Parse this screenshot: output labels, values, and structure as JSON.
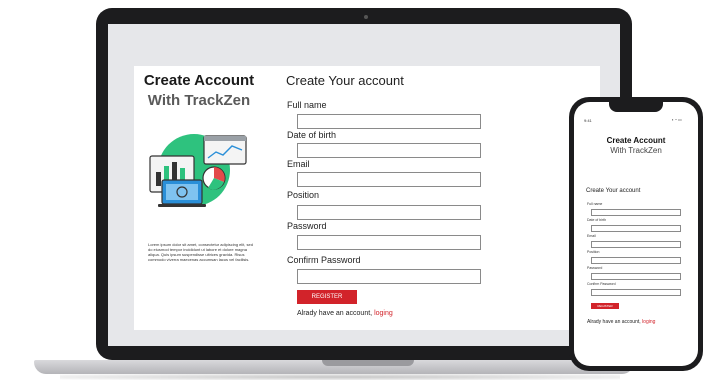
{
  "laptop": {
    "left_title_line1": "Create Account",
    "left_title_line2": "With TrackZen",
    "left_paragraph": "Lorem ipsum dolor sit amet, consectetur adipiscing elit, sed do eiusmod tempor incididunt ut labore et dolore magna aliqua. Quis ipsum suspendisse ultrices gravida. Risus commodo viverra maecenas accumsan lacus vel facilisis.",
    "form_heading": "Create Your account",
    "fields": [
      {
        "label": "Full name",
        "value": ""
      },
      {
        "label": "Date of birth",
        "value": ""
      },
      {
        "label": "Email",
        "value": ""
      },
      {
        "label": "Position",
        "value": ""
      },
      {
        "label": "Password",
        "value": ""
      },
      {
        "label": "Confirm Password",
        "value": ""
      }
    ],
    "register_label": "REGISTER",
    "signin_text": "Alrady have an account,",
    "signin_link": "loging"
  },
  "phone": {
    "time": "9:41",
    "status": "▪ ◔ ▭",
    "title_line1": "Create Account",
    "title_line2": "With TrackZen",
    "form_heading": "Create Your account",
    "fields": [
      {
        "label": "Full name"
      },
      {
        "label": "Date of birth"
      },
      {
        "label": "Email"
      },
      {
        "label": "Position"
      },
      {
        "label": "Password"
      },
      {
        "label": "Confirm Password"
      }
    ],
    "register_label": "REGISTER",
    "signin_text": "Alrady have an account,",
    "signin_link": "loging"
  },
  "colors": {
    "accent": "#d2232a",
    "illustration_green": "#2ec27e",
    "illustration_blue": "#2a8fd8"
  }
}
